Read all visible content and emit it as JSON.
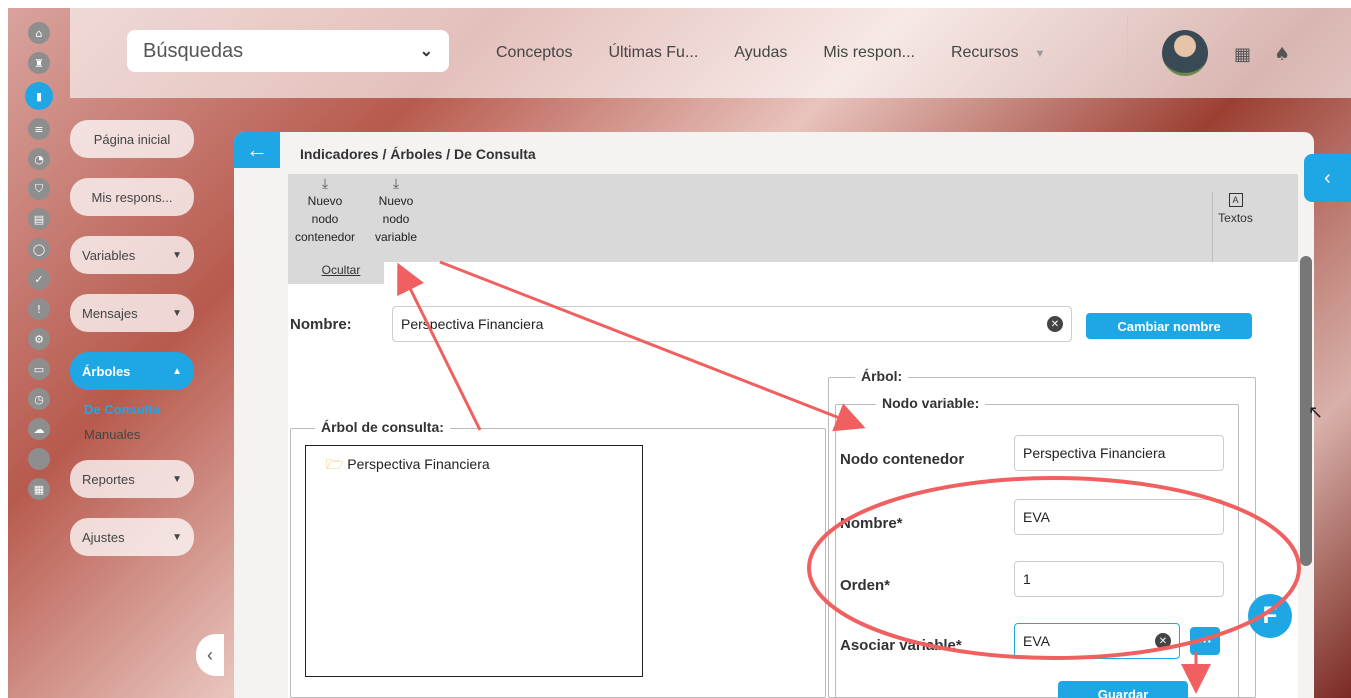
{
  "topbar": {
    "search_label": "Búsquedas",
    "nav": [
      "Conceptos",
      "Últimas Fu...",
      "Ayudas",
      "Mis respon...",
      "Recursos"
    ]
  },
  "rail_icons": [
    "home-icon",
    "chess-icon",
    "chart-icon",
    "list-icon",
    "pie-icon",
    "shield-icon",
    "document-icon",
    "circle-icon",
    "check-icon",
    "warning-icon",
    "gears-icon",
    "presentation-icon",
    "clock-icon",
    "cloud-icon",
    "blank-icon",
    "calendar-icon"
  ],
  "menu": {
    "items": [
      {
        "label": "Página inicial"
      },
      {
        "label": "Mis respons..."
      },
      {
        "label": "Variables"
      },
      {
        "label": "Mensajes"
      },
      {
        "label": "Árboles"
      },
      {
        "label": "Reportes"
      },
      {
        "label": "Ajustes"
      }
    ],
    "sub": [
      "De Consulta",
      "Manuales"
    ]
  },
  "panel": {
    "breadcrumb": "Indicadores / Árboles / De Consulta",
    "toolbar": {
      "new_container": [
        "Nuevo",
        "nodo",
        "contenedor"
      ],
      "new_variable": [
        "Nuevo",
        "nodo",
        "variable"
      ],
      "hide": "Ocultar",
      "texts": "Textos"
    },
    "name_label": "Nombre:",
    "name_value": "Perspectiva Financiera",
    "rename_button": "Cambiar nombre",
    "tree_legend": "Árbol de consulta:",
    "tree_root": "Perspectiva Financiera",
    "arbol_legend": "Árbol:",
    "node_legend": "Nodo variable:",
    "form": {
      "container_label": "Nodo contenedor",
      "container_value": "Perspectiva Financiera",
      "nombre_label": "Nombre*",
      "nombre_value": "EVA",
      "orden_label": "Orden*",
      "orden_value": "1",
      "asociar_label": "Asociar variable*",
      "asociar_value": "EVA",
      "save_button": "Guardar"
    }
  },
  "colors": {
    "accent": "#1ea7e4",
    "annotation": "#f06060"
  }
}
